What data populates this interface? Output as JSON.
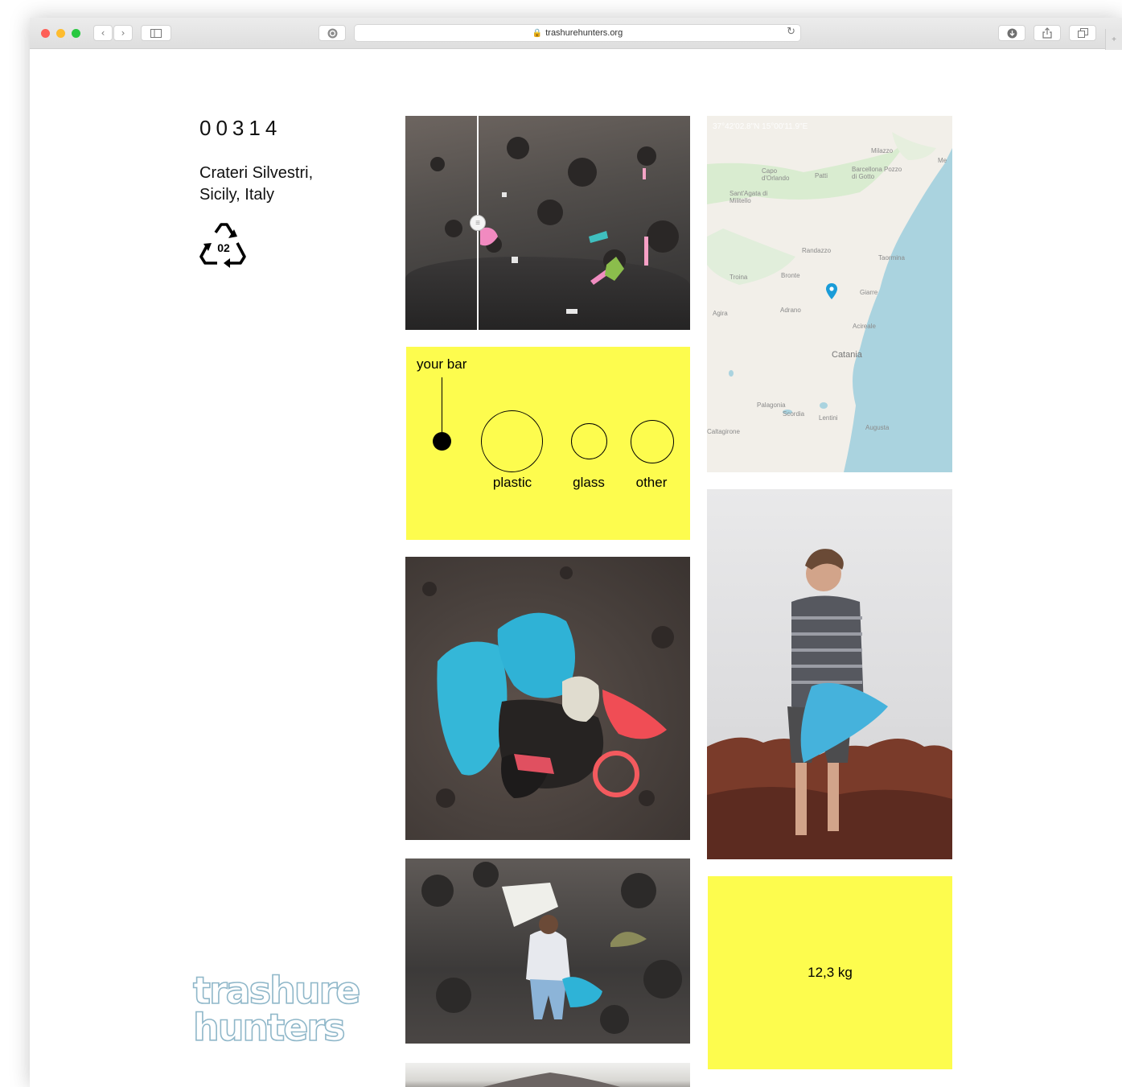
{
  "browser": {
    "url": "trashurehunters.org",
    "traffic_lights": [
      "#fe5f57",
      "#febc2e",
      "#28c840"
    ]
  },
  "record": {
    "id": "00314",
    "location_line1": "Crateri Silvestri,",
    "location_line2": "Sicily, Italy",
    "recycle_code": "02"
  },
  "bar_card": {
    "your_bar_label": "your bar",
    "categories": [
      "plastic",
      "glass",
      "other"
    ]
  },
  "map": {
    "coordinates": "37°42'02.8\"N 15°00'11.9\"E",
    "places": [
      "Milazzo",
      "Barcellona Pozzo di Gotto",
      "Capo d'Orlando",
      "Patti",
      "Sant'Agata di Militello",
      "Randazzo",
      "Taormina",
      "Troina",
      "Bronte",
      "Giarre",
      "Adrano",
      "Agira",
      "Acireale",
      "Catania",
      "Palagonia",
      "Scordia",
      "Lentini",
      "Augusta",
      "Caltagirone",
      "Me"
    ]
  },
  "weight": {
    "value": "12,3 kg"
  },
  "logo": {
    "line1": "trashure",
    "line2": "hunters"
  },
  "colors": {
    "accent_yellow": "#fdfc4e",
    "map_pin": "#1a9cd8"
  }
}
